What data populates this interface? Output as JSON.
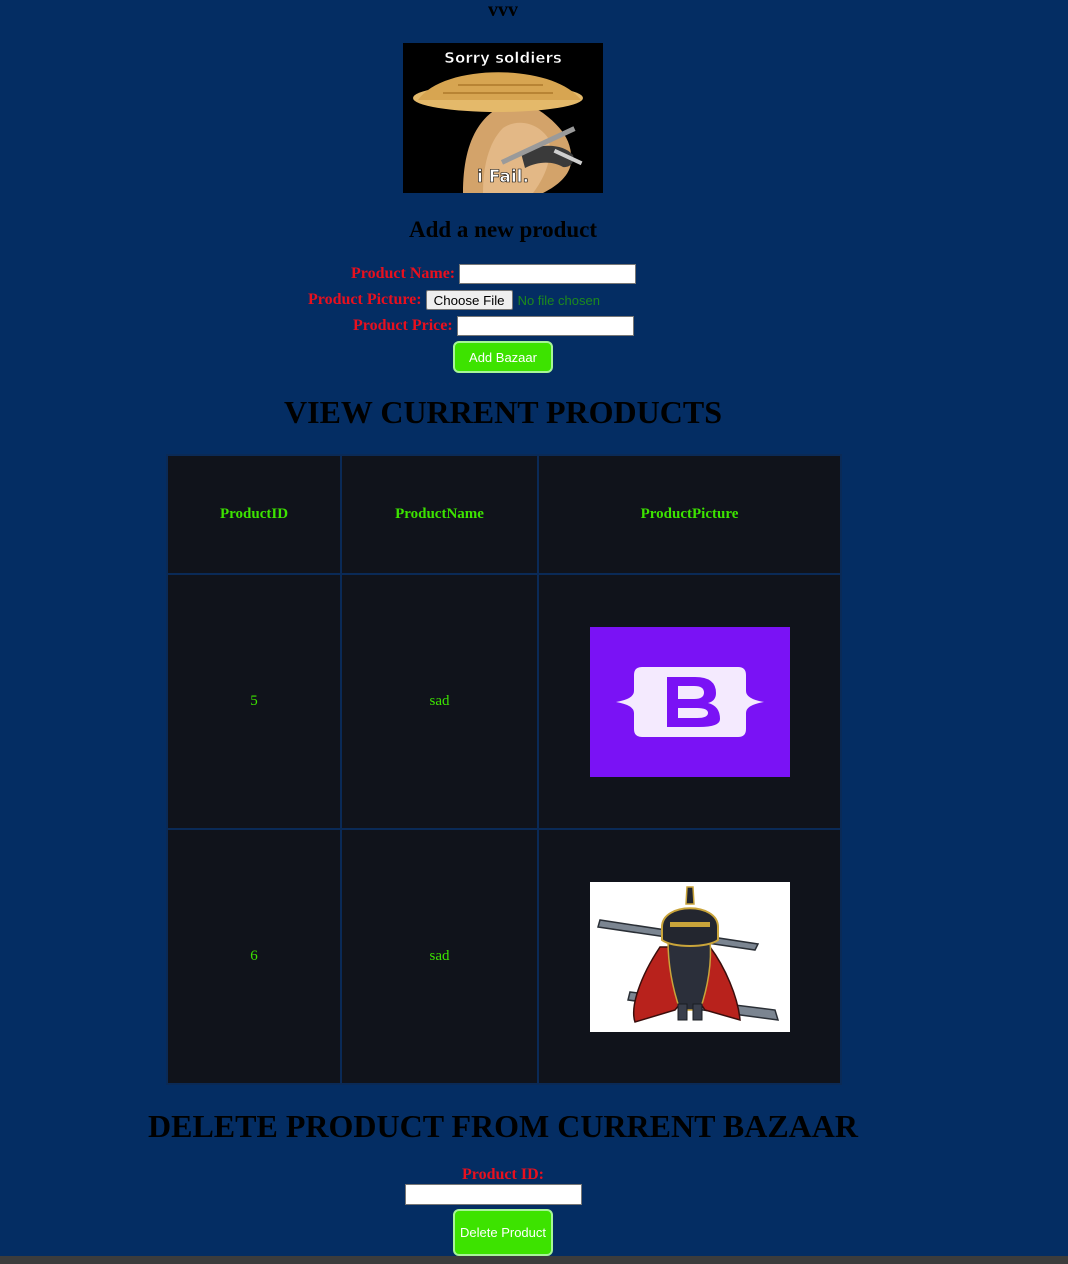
{
  "page": {
    "top_title": "vvv",
    "hero_image": {
      "caption_top": "Sorry soldiers",
      "caption_bottom": "i Fail."
    }
  },
  "add_form": {
    "heading": "Add a new product",
    "name_label": "Product Name:",
    "name_value": "",
    "picture_label": "Product Picture:",
    "choose_file_label": "Choose File",
    "file_status": "No file chosen",
    "price_label": "Product Price:",
    "price_value": "",
    "submit_label": "Add Bazaar"
  },
  "products": {
    "heading": "VIEW CURRENT PRODUCTS",
    "columns": [
      "ProductID",
      "ProductName",
      "ProductPicture"
    ],
    "rows": [
      {
        "id": "5",
        "name": "sad",
        "picture": "bootstrap-logo"
      },
      {
        "id": "6",
        "name": "sad",
        "picture": "armored-knight-chibi"
      }
    ]
  },
  "delete_form": {
    "heading": "DELETE PRODUCT FROM CURRENT BAZAAR",
    "id_label": "Product ID:",
    "id_value": "",
    "submit_label": "Delete Product"
  },
  "colors": {
    "background": "#042d63",
    "label_red": "#e8101e",
    "accent_green": "#3de300",
    "table_bg": "#10131b",
    "bootstrap_purple": "#7a12f5"
  }
}
